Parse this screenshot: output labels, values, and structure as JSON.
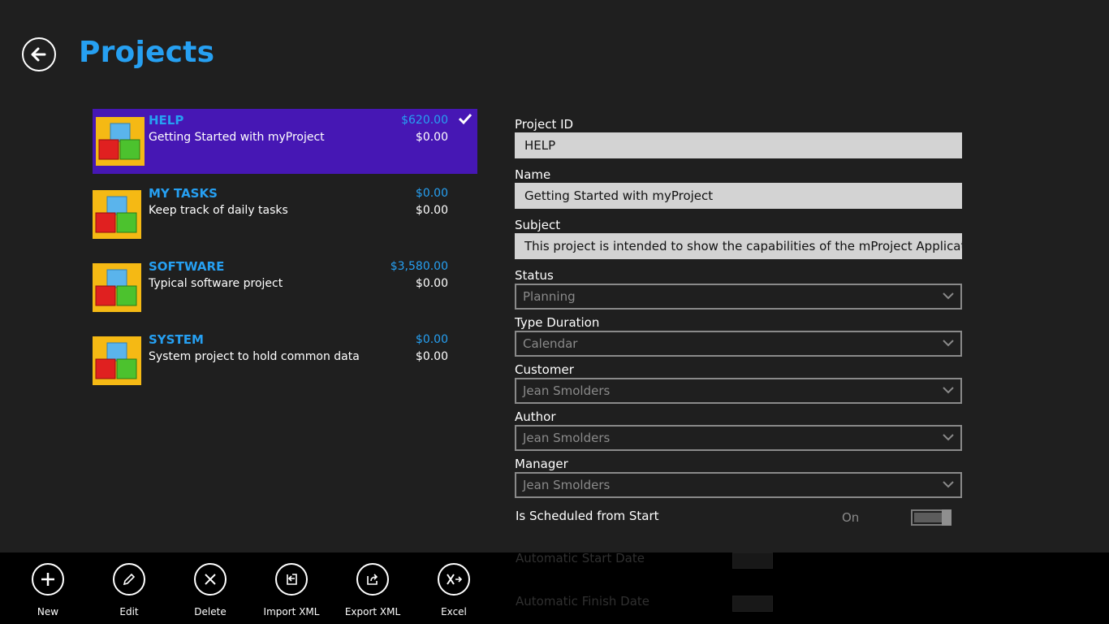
{
  "header": {
    "title": "Projects"
  },
  "projects": [
    {
      "id": "HELP",
      "name": "Getting Started with myProject",
      "amount1": "$620.00",
      "amount2": "$0.00",
      "selected": true
    },
    {
      "id": "MY TASKS",
      "name": "Keep track of daily tasks",
      "amount1": "$0.00",
      "amount2": "$0.00"
    },
    {
      "id": "SOFTWARE",
      "name": "Typical software project",
      "amount1": "$3,580.00",
      "amount2": "$0.00"
    },
    {
      "id": "SYSTEM",
      "name": "System project to hold common data",
      "amount1": "$0.00",
      "amount2": "$0.00"
    }
  ],
  "form": {
    "project_id_label": "Project ID",
    "project_id_value": "HELP",
    "name_label": "Name",
    "name_value": "Getting Started with myProject",
    "subject_label": "Subject",
    "subject_value": "This project is intended to show the capabilities of the mProject Application",
    "status_label": "Status",
    "status_value": "Planning",
    "type_duration_label": "Type Duration",
    "type_duration_value": "Calendar",
    "customer_label": "Customer",
    "customer_value": "Jean Smolders",
    "author_label": "Author",
    "author_value": "Jean Smolders",
    "manager_label": "Manager",
    "manager_value": "Jean Smolders",
    "scheduled_label": "Is Scheduled from Start",
    "scheduled_state": "On",
    "auto_start_label": "Automatic Start Date",
    "auto_finish_label": "Automatic Finish Date"
  },
  "appbar": {
    "new": "New",
    "edit": "Edit",
    "delete": "Delete",
    "import_xml": "Import XML",
    "export_xml": "Export XML",
    "excel": "Excel"
  },
  "colors": {
    "accent": "#26a0f2",
    "selected": "#4617b4",
    "background": "#1f1f1f",
    "appbar": "#000000"
  }
}
